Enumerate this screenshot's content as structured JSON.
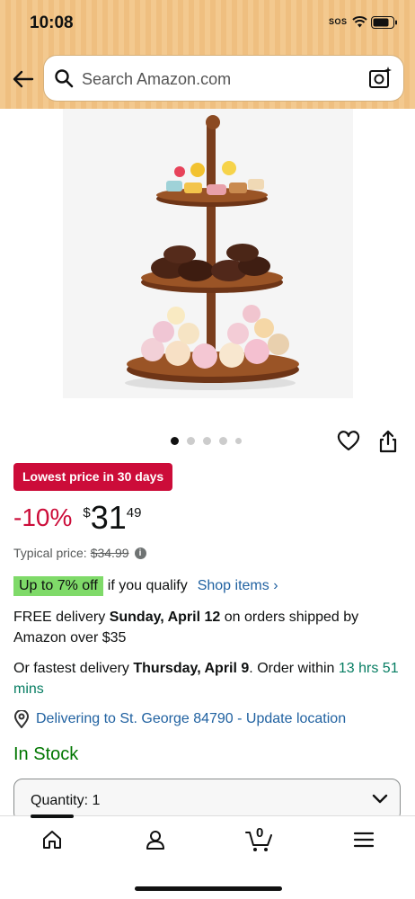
{
  "status_bar": {
    "time": "10:08",
    "carrier": "SOS"
  },
  "search": {
    "placeholder": "Search Amazon.com"
  },
  "gallery": {
    "image_alt": "Three tier wooden dessert stand with pastries, cookies and cupcakes",
    "dot_count": 5,
    "active_dot": 1
  },
  "deal": {
    "badge": "Lowest price in 30 days"
  },
  "price": {
    "discount": "-10%",
    "currency": "$",
    "whole": "31",
    "fraction": "49"
  },
  "typical_price": {
    "label": "Typical price:",
    "value": "$34.99"
  },
  "promo": {
    "tag": "Up to 7% off",
    "text": "if you qualify",
    "link": "Shop items ›"
  },
  "delivery": {
    "prefix": "FREE delivery ",
    "date": "Sunday, April 12",
    "suffix": " on orders shipped by Amazon over $35"
  },
  "fastest": {
    "prefix": "Or fastest delivery ",
    "date": "Thursday, April 9",
    "middle": ". Order within ",
    "countdown": "13 hrs 51 mins"
  },
  "location": {
    "text": "Delivering to St. George 84790 - Update location"
  },
  "stock": {
    "text": "In Stock"
  },
  "quantity": {
    "label": "Quantity: 1"
  },
  "tabbar": {
    "cart_count": "0"
  },
  "colors": {
    "header": "#f3c98f",
    "deal_red": "#cc0c39",
    "link_blue": "#2162a1",
    "stock_green": "#007600",
    "promo_green": "#7fda69"
  }
}
